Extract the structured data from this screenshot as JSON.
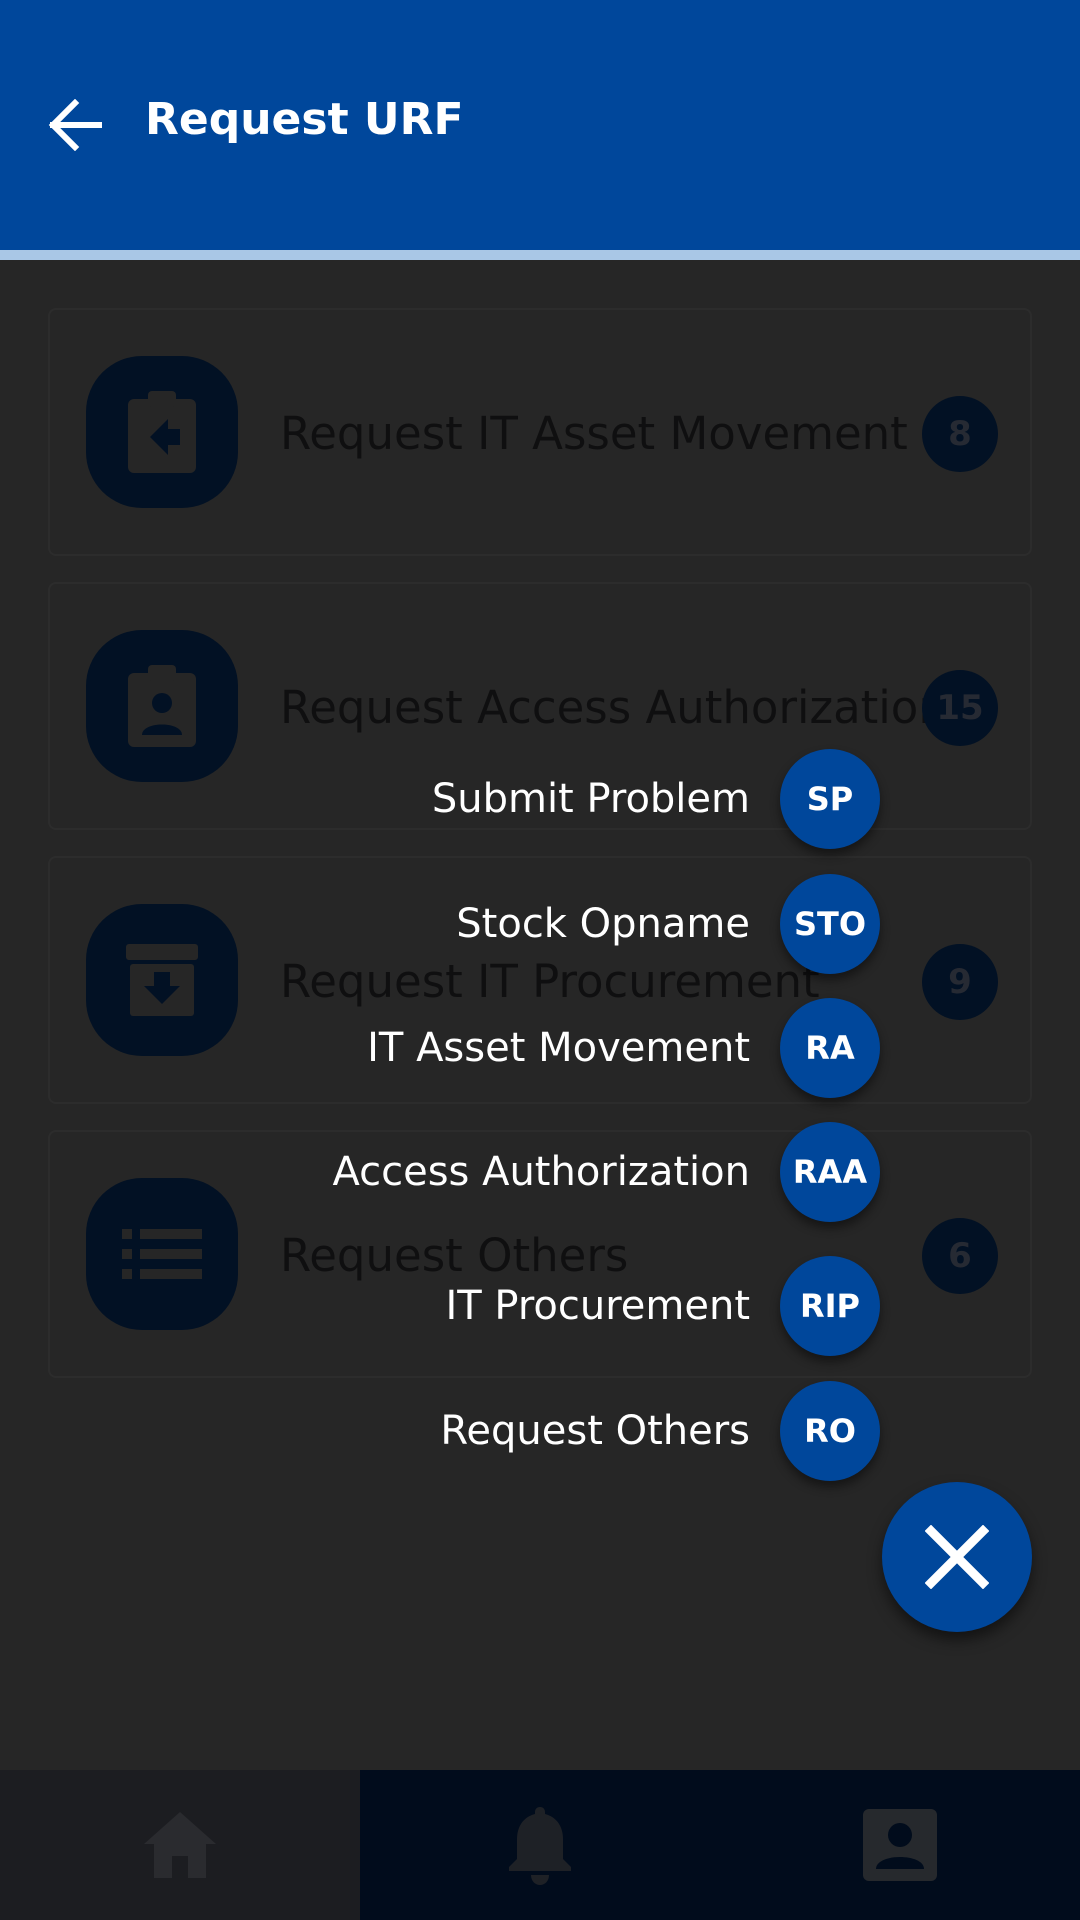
{
  "header": {
    "title": "Request URF",
    "back_icon": "arrow-left-icon",
    "background": "#00479b"
  },
  "cards": [
    {
      "label": "Request IT Asset Movement",
      "count": "8",
      "icon": "clipboard-arrow-left-icon"
    },
    {
      "label": "Request Access Authorization",
      "count": "15",
      "icon": "clipboard-account-icon"
    },
    {
      "label": "Request IT Procurement",
      "count": "9",
      "icon": "archive-arrow-down-icon"
    },
    {
      "label": "Request Others",
      "count": "6",
      "icon": "format-list-bulleted-icon"
    }
  ],
  "speed_dial": {
    "items": [
      {
        "label": "Submit Problem",
        "abbr": "SP"
      },
      {
        "label": "Stock Opname",
        "abbr": "STO"
      },
      {
        "label": "IT Asset Movement",
        "abbr": "RA"
      },
      {
        "label": "Access Authorization",
        "abbr": "RAA"
      },
      {
        "label": "IT Procurement",
        "abbr": "RIP"
      },
      {
        "label": "Request Others",
        "abbr": "RO"
      }
    ],
    "close_icon": "close-icon"
  },
  "bottom_nav": {
    "items": [
      {
        "name": "home",
        "icon": "home-icon"
      },
      {
        "name": "notifications",
        "icon": "bell-icon"
      },
      {
        "name": "profile",
        "icon": "account-box-icon"
      }
    ]
  },
  "colors": {
    "primary": "#00479b",
    "overlay_bg": "#262626",
    "accent_line": "#a9c7e6"
  }
}
